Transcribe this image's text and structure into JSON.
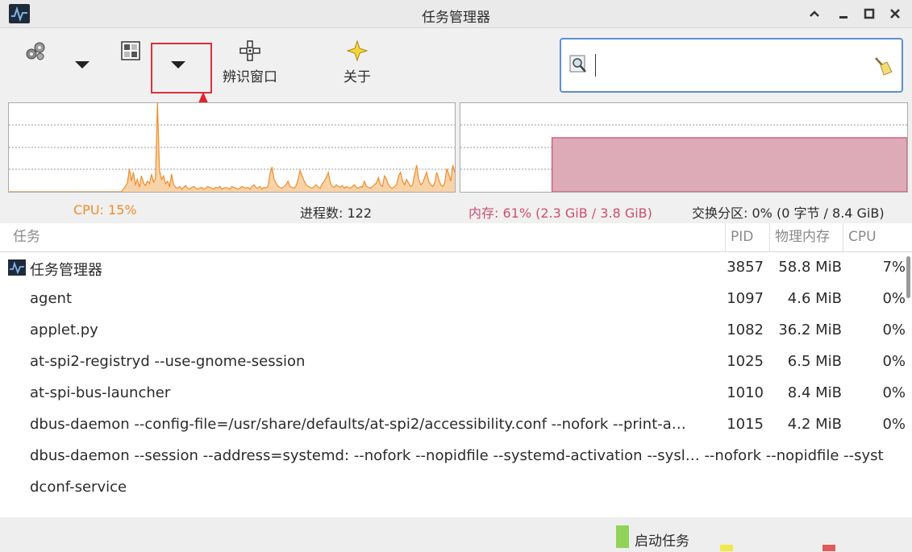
{
  "window": {
    "title": "任务管理器",
    "controls": [
      "^",
      "−",
      "☐",
      "✕"
    ]
  },
  "toolbar": {
    "identify_label": "辨识窗口",
    "about_label": "关于"
  },
  "search": {
    "value": "",
    "placeholder": ""
  },
  "stats": {
    "cpu": "CPU: 15%",
    "processes": "进程数: 122",
    "memory": "内存: 61% (2.3 GiB / 3.8 GiB)",
    "swap": "交换分区: 0% (0 字节 / 8.4 GiB)"
  },
  "colors": {
    "cpu": "#f08c2a",
    "memory": "#cc4f72",
    "memory_fill": "#ddaab7",
    "highlight": "#d8313a"
  },
  "cpu_history": [
    0,
    0,
    0,
    0,
    0,
    0,
    0,
    0,
    0,
    0,
    0,
    0,
    0,
    0,
    0,
    0,
    0,
    0,
    0,
    0,
    0,
    0,
    0,
    0,
    0,
    0,
    0,
    0,
    0,
    0,
    0,
    0,
    0,
    0,
    0,
    0,
    0,
    0,
    0,
    0,
    0,
    0,
    0,
    0,
    0,
    0,
    0,
    0,
    0,
    0,
    0,
    0,
    0,
    0,
    0,
    0,
    0,
    3,
    6,
    10,
    26,
    12,
    22,
    8,
    14,
    5,
    18,
    10,
    7,
    12,
    9,
    20,
    11,
    15,
    100,
    24,
    14,
    18,
    9,
    12,
    6,
    20,
    8,
    5,
    4,
    6,
    3,
    5,
    7,
    4,
    3,
    5,
    6,
    4,
    3,
    4,
    5,
    3,
    4,
    6,
    5,
    4,
    3,
    5,
    4,
    6,
    3,
    4,
    5,
    4,
    3,
    6,
    5,
    4,
    3,
    4,
    6,
    5,
    4,
    5,
    3,
    6,
    8,
    5,
    4,
    6,
    3,
    5,
    4,
    6,
    20,
    28,
    14,
    10,
    6,
    5,
    4,
    6,
    8,
    12,
    6,
    5,
    4,
    7,
    14,
    24,
    18,
    12,
    8,
    6,
    5,
    4,
    6,
    8,
    5,
    4,
    9,
    12,
    16,
    22,
    10,
    6,
    5,
    8,
    6,
    5,
    7,
    4,
    6,
    5,
    4,
    6,
    8,
    5,
    4,
    6,
    5,
    12,
    6,
    5,
    4,
    6,
    8,
    10,
    16,
    8,
    6,
    18,
    14,
    8,
    5,
    4,
    6,
    8,
    18,
    22,
    12,
    8,
    14,
    10,
    6,
    8,
    20,
    30,
    14,
    8,
    10,
    16,
    22,
    12,
    8,
    6,
    10,
    22,
    14,
    8,
    6,
    10,
    26,
    20,
    12,
    30,
    22
  ],
  "memory_history": {
    "start_fraction": 0.205,
    "level_percent": 61
  },
  "table": {
    "headers": {
      "task": "任务",
      "pid": "PID",
      "mem": "物理内存",
      "cpu": "CPU"
    },
    "rows": [
      {
        "name": "任务管理器",
        "pid": "3857",
        "mem": "58.8 MiB",
        "cpu": "7%"
      },
      {
        "name": "agent",
        "pid": "1097",
        "mem": "4.6 MiB",
        "cpu": "0%"
      },
      {
        "name": "applet.py",
        "pid": "1082",
        "mem": "36.2 MiB",
        "cpu": "0%"
      },
      {
        "name": "at-spi2-registryd --use-gnome-session",
        "pid": "1025",
        "mem": "6.5 MiB",
        "cpu": "0%"
      },
      {
        "name": "at-spi-bus-launcher",
        "pid": "1010",
        "mem": "8.4 MiB",
        "cpu": "0%"
      },
      {
        "name": "dbus-daemon --config-file=/usr/share/defaults/at-spi2/accessibility.conf --nofork --print-a…",
        "pid": "1015",
        "mem": "4.2 MiB",
        "cpu": "0%"
      },
      {
        "name": "dbus-daemon --session --address=systemd: --nofork --nopidfile --systemd-activation --sysl… --nofork --nopidfile --syst",
        "pid": "",
        "mem": "",
        "cpu": ""
      },
      {
        "name": "dconf-service",
        "pid": "",
        "mem": "",
        "cpu": ""
      }
    ]
  },
  "statusbar": {
    "legend_label": "启动任务"
  }
}
